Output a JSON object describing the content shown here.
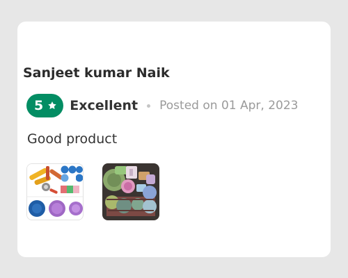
{
  "review": {
    "reviewer_name": "Sanjeet kumar Naik",
    "rating_value": "5",
    "rating_label": "Excellent",
    "posted_text": "Posted on 01 Apr, 2023",
    "review_text": "Good product"
  },
  "colors": {
    "page_background": "#e7e7e7",
    "card_background": "#ffffff",
    "rating_badge": "#038d63",
    "primary_text": "#333333",
    "secondary_text": "#9a9a9a"
  },
  "icons": {
    "rating_star": "star-icon",
    "separator": "dot-separator"
  },
  "images": [
    {
      "name": "product-thumbnail-1"
    },
    {
      "name": "product-thumbnail-2"
    }
  ]
}
